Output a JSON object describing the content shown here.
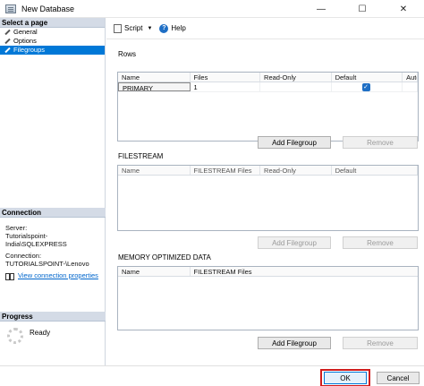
{
  "window": {
    "title": "New Database",
    "controls": {
      "minimize": "—",
      "maximize": "☐",
      "close": "✕"
    }
  },
  "left": {
    "select_page_header": "Select a page",
    "pages": [
      {
        "label": "General",
        "selected": false
      },
      {
        "label": "Options",
        "selected": false
      },
      {
        "label": "Filegroups",
        "selected": true
      }
    ],
    "connection_header": "Connection",
    "server_label": "Server:",
    "server_value": "Tutorialspoint-India\\SQLEXPRESS",
    "connection_label": "Connection:",
    "connection_value": "TUTORIALSPOINT-\\Lenovo",
    "view_connection_link": "View connection properties",
    "progress_header": "Progress",
    "progress_status": "Ready"
  },
  "toolbar": {
    "script_label": "Script",
    "dropdown_glyph": "▼",
    "help_glyph": "?",
    "help_label": "Help"
  },
  "rows": {
    "label": "Rows",
    "columns": [
      "Name",
      "Files",
      "Read-Only",
      "Default",
      "Auto"
    ],
    "data": [
      {
        "name": "PRIMARY",
        "files": "1",
        "read_only": "",
        "default_checked": true,
        "checkmark": "✓",
        "auto": ""
      }
    ],
    "add_button": "Add Filegroup",
    "remove_button": "Remove"
  },
  "filestream": {
    "label": "FILESTREAM",
    "columns": [
      "Name",
      "FILESTREAM Files",
      "Read-Only",
      "Default"
    ],
    "add_button": "Add Filegroup",
    "remove_button": "Remove"
  },
  "memory_optimized": {
    "label": "MEMORY OPTIMIZED DATA",
    "columns": [
      "Name",
      "FILESTREAM Files"
    ],
    "add_button": "Add Filegroup",
    "remove_button": "Remove"
  },
  "footer": {
    "ok_button": "OK",
    "cancel_button": "Cancel",
    "highlight_color": "#d01c1c"
  },
  "colors": {
    "accent": "#0078d7",
    "section_header_bg": "#d4dbe6"
  }
}
